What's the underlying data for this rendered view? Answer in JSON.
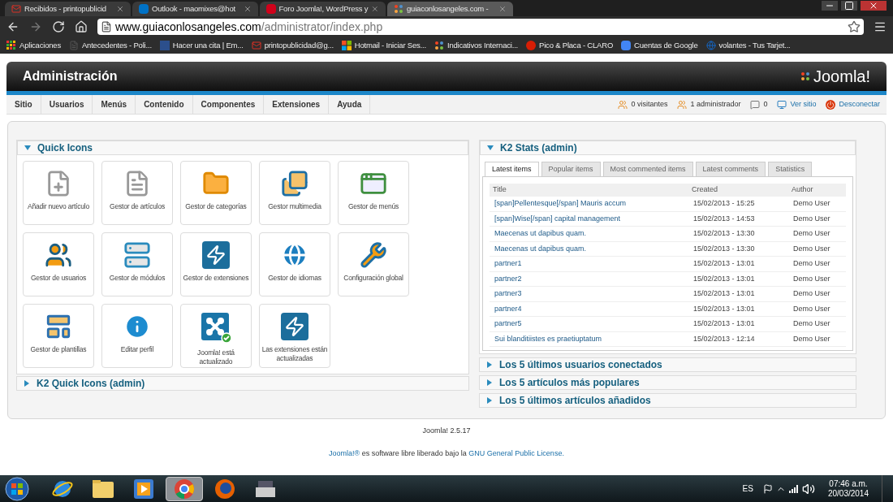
{
  "browser": {
    "tabs": [
      {
        "title": "Recibidos - printopublicid",
        "kind": "mail",
        "selected": false
      },
      {
        "title": "Outlook - maomixes@hot",
        "kind": "outlook",
        "selected": false
      },
      {
        "title": "Foro Joomla!, WordPress y",
        "kind": "forum",
        "selected": false
      },
      {
        "title": "guiaconlosangeles.com -",
        "kind": "joomla",
        "selected": true
      }
    ],
    "url": {
      "host": "www.guiaconlosangeles.com",
      "path": "/administrator/index.php"
    },
    "bookmarks": [
      {
        "label": "Aplicaciones",
        "kind": "apps"
      },
      {
        "label": "Antecedentes - Poli...",
        "kind": "page"
      },
      {
        "label": "Hacer una cita | Em...",
        "kind": "doc"
      },
      {
        "label": "printopublicidad@g...",
        "kind": "mail"
      },
      {
        "label": "Hotmail - Iniciar Ses...",
        "kind": "windows"
      },
      {
        "label": "Indicativos Internaci...",
        "kind": "joomla"
      },
      {
        "label": "Pico & Placa - CLARO",
        "kind": "claro"
      },
      {
        "label": "Cuentas de Google",
        "kind": "google"
      },
      {
        "label": "volantes - Tus Tarjet...",
        "kind": "globe"
      }
    ]
  },
  "admin": {
    "title": "Administración",
    "logo": "Joomla!",
    "menu": [
      "Sitio",
      "Usuarios",
      "Menús",
      "Contenido",
      "Componentes",
      "Extensiones",
      "Ayuda"
    ],
    "status": [
      {
        "label": "0 visitantes",
        "kind": "users",
        "link": false
      },
      {
        "label": "1 administrador",
        "kind": "users",
        "link": false
      },
      {
        "label": "0",
        "kind": "messages",
        "link": false
      },
      {
        "label": "Ver sitio",
        "kind": "site",
        "link": true
      },
      {
        "label": "Desconectar",
        "kind": "logout",
        "link": true
      }
    ]
  },
  "quick_icons": {
    "title": "Quick Icons",
    "expanded": true,
    "items": [
      {
        "label": "Añadir nuevo artículo",
        "kind": "add-article"
      },
      {
        "label": "Gestor de artículos",
        "kind": "articles"
      },
      {
        "label": "Gestor de categorías",
        "kind": "categories"
      },
      {
        "label": "Gestor multimedia",
        "kind": "media"
      },
      {
        "label": "Gestor de menús",
        "kind": "menus"
      },
      {
        "label": "Gestor de usuarios",
        "kind": "users"
      },
      {
        "label": "Gestor de módulos",
        "kind": "modules"
      },
      {
        "label": "Gestor de extensiones",
        "kind": "extensions"
      },
      {
        "label": "Gestor de idiomas",
        "kind": "languages"
      },
      {
        "label": "Configuración global",
        "kind": "config"
      },
      {
        "label": "Gestor de plantillas",
        "kind": "templates"
      },
      {
        "label": "Editar perfil",
        "kind": "profile"
      },
      {
        "label": "Joomla! está actualizado",
        "kind": "joomla-update"
      },
      {
        "label": "Las extensiones están actualizadas",
        "kind": "extensions"
      }
    ]
  },
  "k2_quick_icons": {
    "title": "K2 Quick Icons (admin)",
    "expanded": false
  },
  "k2_stats": {
    "title": "K2 Stats (admin)",
    "expanded": true,
    "tabs": [
      {
        "label": "Latest items",
        "selected": true
      },
      {
        "label": "Popular items",
        "selected": false
      },
      {
        "label": "Most commented items",
        "selected": false
      },
      {
        "label": "Latest comments",
        "selected": false
      },
      {
        "label": "Statistics",
        "selected": false
      }
    ],
    "columns": [
      "Title",
      "Created",
      "Author"
    ],
    "rows": [
      {
        "title": "[span]Pellentesque[/span] Mauris accum",
        "created": "15/02/2013 - 15:25",
        "author": "Demo User"
      },
      {
        "title": "[span]Wise[/span] capital management",
        "created": "15/02/2013 - 14:53",
        "author": "Demo User"
      },
      {
        "title": "Maecenas ut dapibus quam.",
        "created": "15/02/2013 - 13:30",
        "author": "Demo User"
      },
      {
        "title": "Maecenas ut dapibus quam.",
        "created": "15/02/2013 - 13:30",
        "author": "Demo User"
      },
      {
        "title": "partner1",
        "created": "15/02/2013 - 13:01",
        "author": "Demo User"
      },
      {
        "title": "partner2",
        "created": "15/02/2013 - 13:01",
        "author": "Demo User"
      },
      {
        "title": "partner3",
        "created": "15/02/2013 - 13:01",
        "author": "Demo User"
      },
      {
        "title": "partner4",
        "created": "15/02/2013 - 13:01",
        "author": "Demo User"
      },
      {
        "title": "partner5",
        "created": "15/02/2013 - 13:01",
        "author": "Demo User"
      },
      {
        "title": "Sui blanditiistes es praetiuptatum",
        "created": "15/02/2013 - 12:14",
        "author": "Demo User"
      }
    ]
  },
  "panels": [
    {
      "title": "Los 5 últimos usuarios conectados",
      "expanded": false
    },
    {
      "title": "Los 5 artículos más populares",
      "expanded": false
    },
    {
      "title": "Los 5 últimos artículos añadidos",
      "expanded": false
    }
  ],
  "footer": {
    "version": "Joomla! 2.5.17",
    "license": [
      {
        "text": "Joomla!®",
        "link": true
      },
      {
        "text": " es software libre liberado bajo la ",
        "link": false
      },
      {
        "text": "GNU General Public License.",
        "link": true
      }
    ]
  },
  "taskbar": {
    "apps": [
      {
        "kind": "ie",
        "selected": false
      },
      {
        "kind": "explorer",
        "selected": false
      },
      {
        "kind": "media",
        "selected": false
      },
      {
        "kind": "chrome",
        "selected": true
      },
      {
        "kind": "firefox",
        "selected": false
      },
      {
        "kind": "app",
        "selected": false
      }
    ],
    "language": "ES",
    "time": "07:46 a.m.",
    "date": "20/03/2014"
  }
}
